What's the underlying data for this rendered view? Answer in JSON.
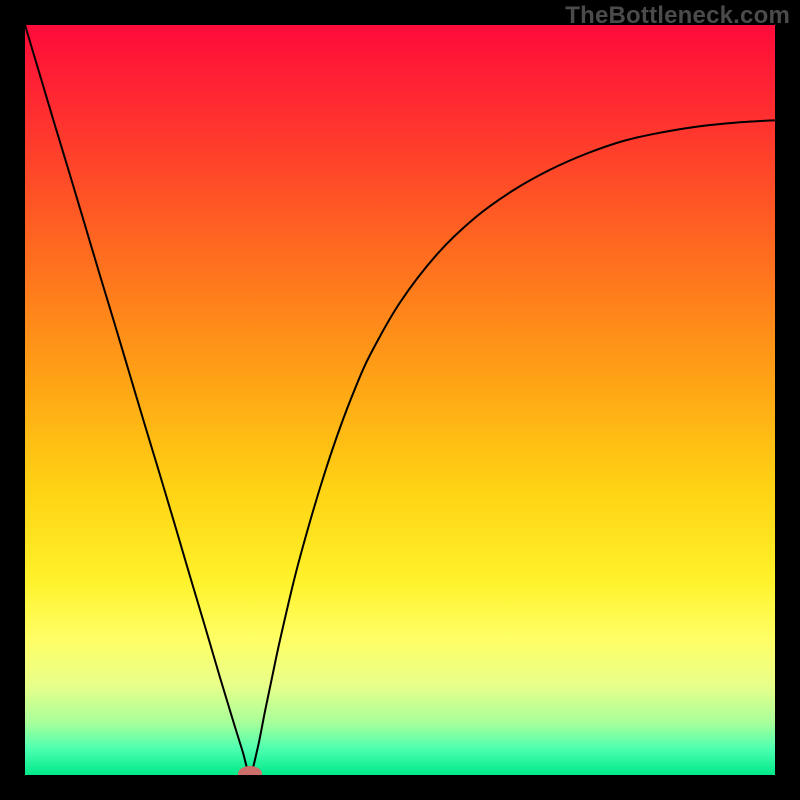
{
  "watermark": "TheBottleneck.com",
  "chart_data": {
    "type": "line",
    "title": "",
    "xlabel": "",
    "ylabel": "",
    "xlim": [
      0,
      100
    ],
    "ylim": [
      0,
      100
    ],
    "grid": false,
    "legend": false,
    "gradient_stops": [
      {
        "offset": 0.0,
        "color": "#ff0b3a"
      },
      {
        "offset": 0.12,
        "color": "#ff2f30"
      },
      {
        "offset": 0.3,
        "color": "#ff6a1f"
      },
      {
        "offset": 0.48,
        "color": "#ffa515"
      },
      {
        "offset": 0.62,
        "color": "#ffd314"
      },
      {
        "offset": 0.74,
        "color": "#fff22a"
      },
      {
        "offset": 0.82,
        "color": "#ffff66"
      },
      {
        "offset": 0.88,
        "color": "#e8ff8a"
      },
      {
        "offset": 0.93,
        "color": "#a8ff9a"
      },
      {
        "offset": 0.965,
        "color": "#4dffb0"
      },
      {
        "offset": 1.0,
        "color": "#00e989"
      }
    ],
    "series": [
      {
        "name": "curve",
        "color": "#000000",
        "width": 2,
        "x": [
          0,
          2,
          4,
          6,
          8,
          10,
          12,
          14,
          16,
          18,
          20,
          22,
          24,
          26,
          27,
          28,
          29,
          30,
          31,
          32,
          33,
          34,
          36,
          38,
          40,
          42,
          44,
          46,
          50,
          55,
          60,
          65,
          70,
          75,
          80,
          85,
          90,
          95,
          100
        ],
        "y": [
          100,
          93.3,
          86.6,
          80.0,
          73.3,
          66.6,
          60.0,
          53.3,
          46.6,
          40.0,
          33.3,
          26.5,
          19.8,
          13.0,
          9.7,
          6.4,
          3.2,
          0.2,
          3.5,
          8.5,
          13.3,
          18.0,
          26.5,
          33.8,
          40.4,
          46.3,
          51.5,
          56.0,
          63.0,
          69.5,
          74.3,
          77.9,
          80.7,
          82.9,
          84.6,
          85.7,
          86.5,
          87.0,
          87.3
        ]
      }
    ],
    "marker": {
      "x": 30,
      "y": 0.2,
      "rx": 1.6,
      "ry": 1.0,
      "color": "#cc6f6a"
    }
  }
}
